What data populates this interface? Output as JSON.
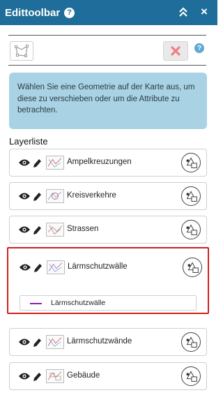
{
  "header": {
    "title": "Edittoolbar",
    "help": "?",
    "close": "×"
  },
  "toolbar": {
    "help": "?"
  },
  "info": {
    "text": "Wählen Sie eine Geometrie auf der Karte aus, um diese zu verschieben oder um die Attribute zu betrachten."
  },
  "layer_list": {
    "title": "Layerliste",
    "layers": [
      {
        "name": "Ampelkreuzungen"
      },
      {
        "name": "Kreisverkehre"
      },
      {
        "name": "Strassen"
      },
      {
        "name": "Lärmschutzwälle",
        "legend": "Lärmschutzwälle",
        "legend_color": "#8b1fb0"
      },
      {
        "name": "Lärmschutzwände"
      },
      {
        "name": "Gebäude"
      }
    ]
  },
  "colors": {
    "header": "#1f6d9a",
    "info_bg": "#a9d3e4",
    "selected_border": "#d0201e",
    "delete_icon": "#ef7f84"
  }
}
